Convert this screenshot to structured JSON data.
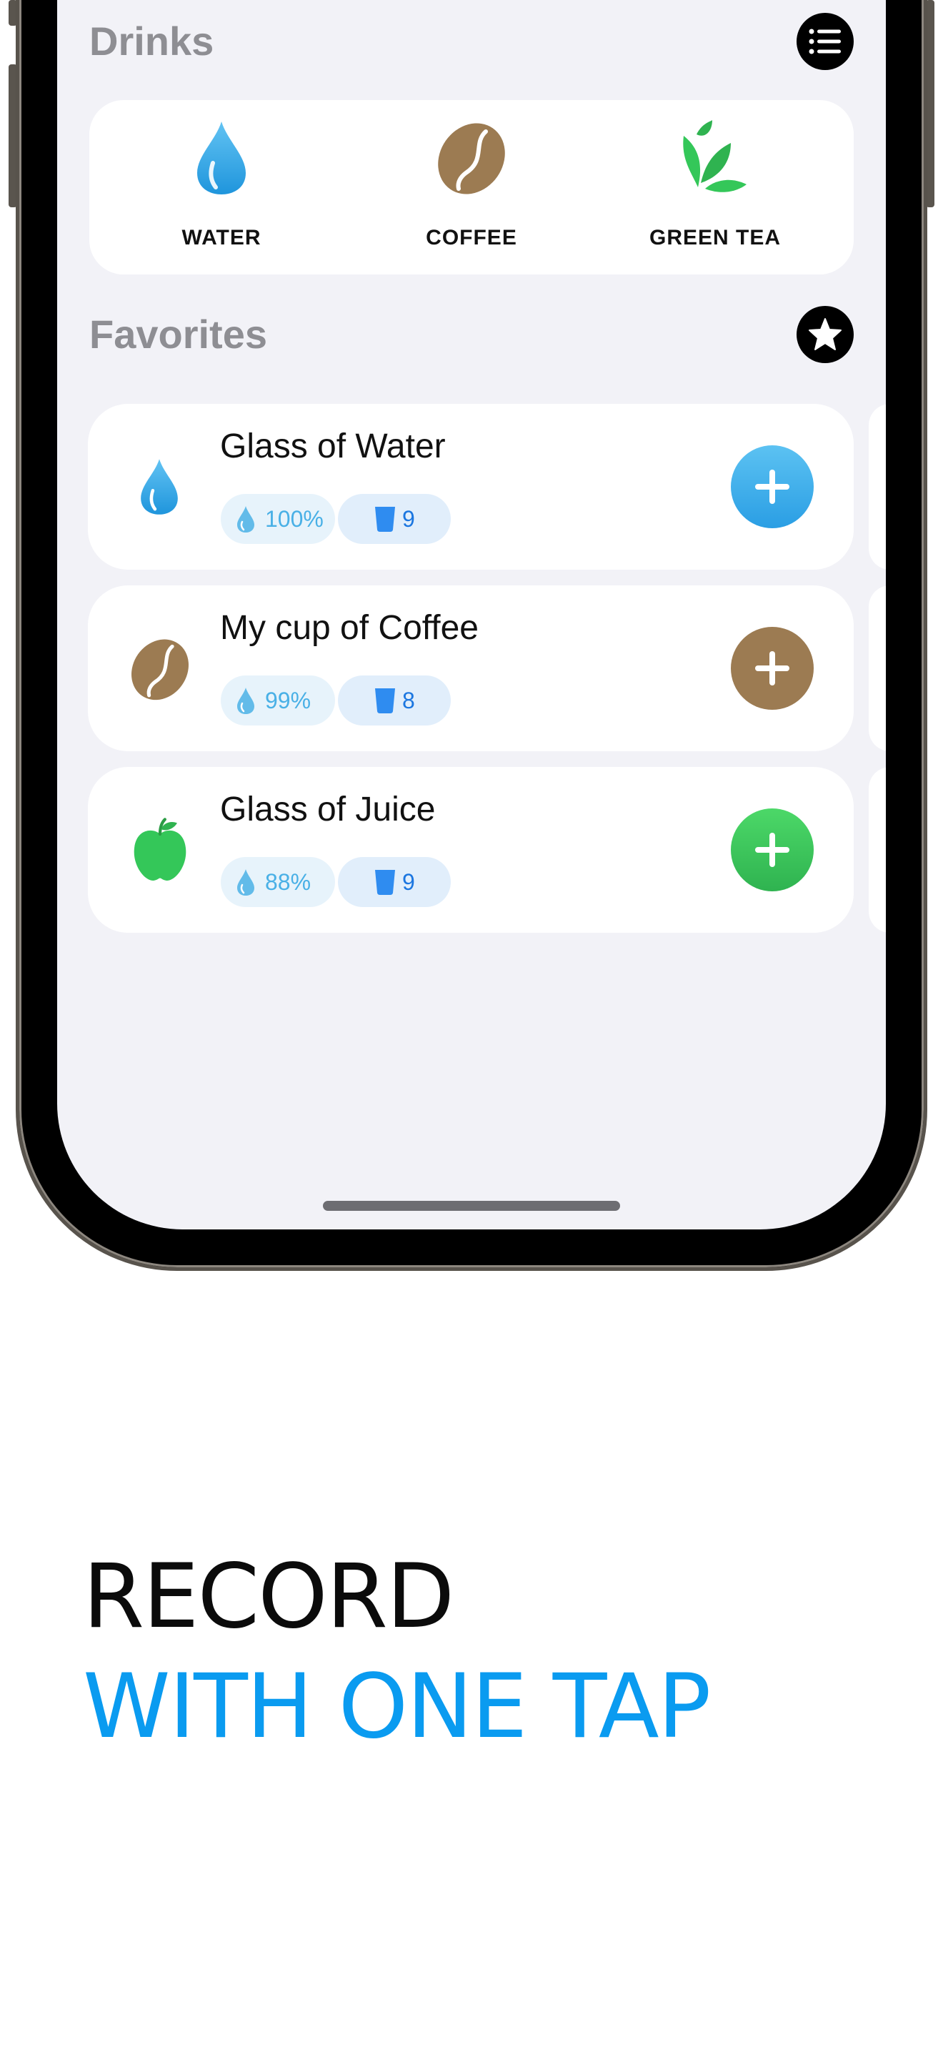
{
  "drinks_section": {
    "title": "Drinks",
    "menu_icon": "list-icon",
    "items": [
      {
        "label": "WATER",
        "icon": "water-drop-icon",
        "color": "#35a7e8"
      },
      {
        "label": "COFFEE",
        "icon": "coffee-bean-icon",
        "color": "#9c7b52"
      },
      {
        "label": "GREEN TEA",
        "icon": "tea-leaves-icon",
        "color": "#34c759"
      }
    ]
  },
  "favorites_section": {
    "title": "Favorites",
    "star_icon": "star-icon",
    "items": [
      {
        "name": "Glass of Water",
        "hydration": "100%",
        "count": "9",
        "icon": "water-drop-icon",
        "button_color": "#35a7e8"
      },
      {
        "name": "My cup of Coffee",
        "hydration": "99%",
        "count": "8",
        "icon": "coffee-bean-icon",
        "button_color": "#9c7b52"
      },
      {
        "name": "Glass of Juice",
        "hydration": "88%",
        "count": "9",
        "icon": "apple-icon",
        "button_color": "#34c759"
      }
    ]
  },
  "headline": {
    "line1": "RECORD",
    "line2": "WITH ONE TAP"
  },
  "colors": {
    "accent_blue": "#0a9bf0",
    "screen_bg": "#f2f2f7"
  }
}
